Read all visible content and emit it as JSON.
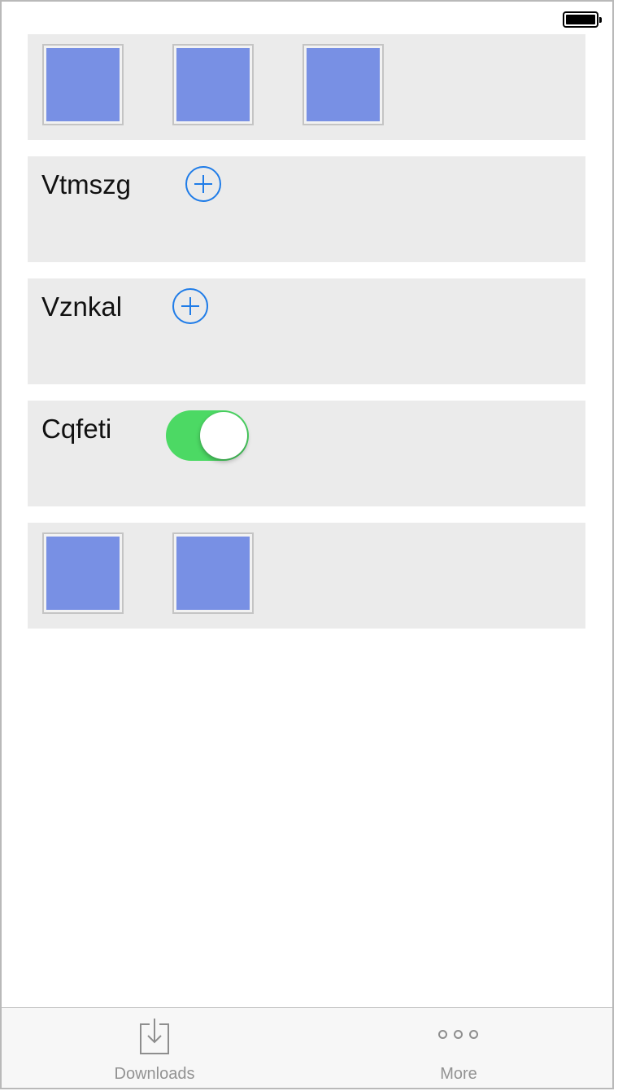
{
  "status_bar": {
    "battery_icon": "battery-full-icon"
  },
  "rows": [
    {
      "type": "image-group",
      "tile_count": 3,
      "tile_color": "#7890e4"
    },
    {
      "type": "label-add",
      "label": "Vtmszg",
      "icon": "add-circle-icon",
      "accent": "#1f7ce8"
    },
    {
      "type": "label-add",
      "label": "Vznkal",
      "icon": "add-circle-icon",
      "accent": "#1f7ce8"
    },
    {
      "type": "label-toggle",
      "label": "Cqfeti",
      "toggle_on": true,
      "toggle_color": "#4cd964"
    },
    {
      "type": "image-group",
      "tile_count": 2,
      "tile_color": "#7890e4"
    }
  ],
  "tabbar": {
    "tabs": [
      {
        "label": "Downloads",
        "icon": "downloads-icon"
      },
      {
        "label": "More",
        "icon": "more-icon"
      }
    ]
  }
}
